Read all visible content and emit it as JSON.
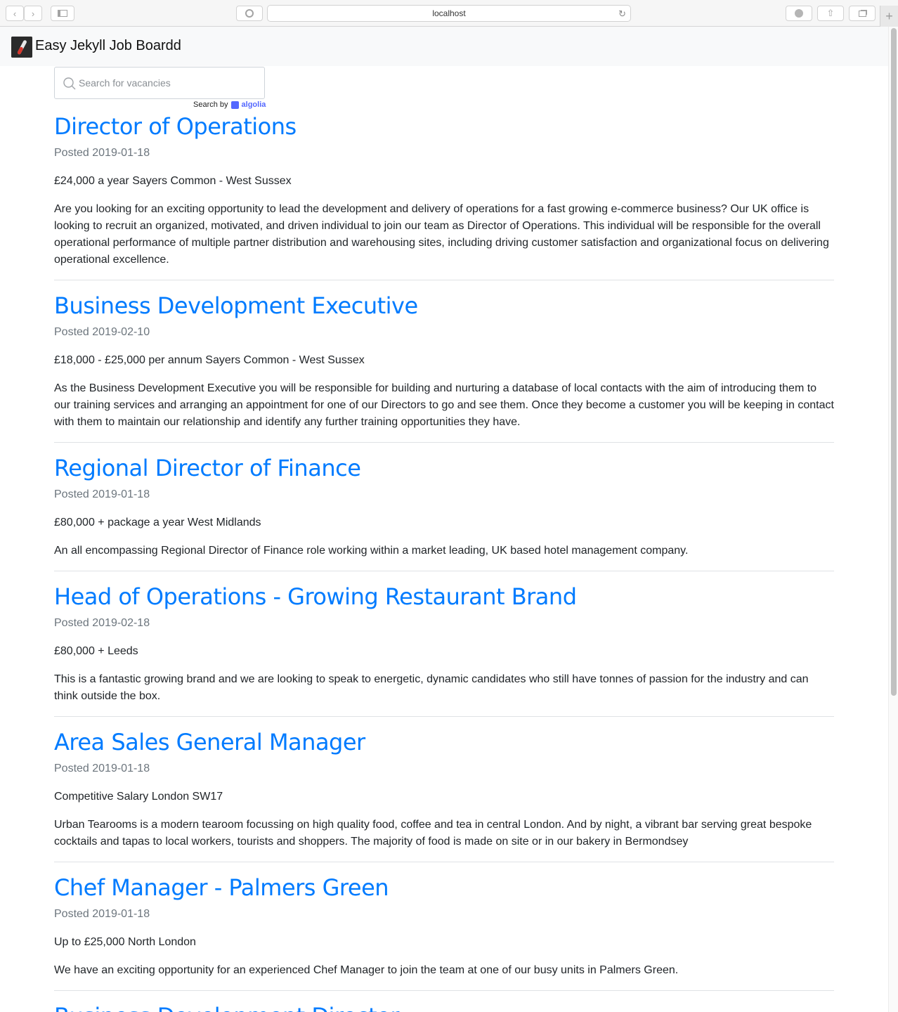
{
  "browser": {
    "url": "localhost"
  },
  "navbar": {
    "brand": "Easy Jekyll Job Boardd"
  },
  "search": {
    "placeholder": "Search for vacancies",
    "powered_by": "Search by",
    "provider": "algolia"
  },
  "jobs": [
    {
      "title": "Director of Operations",
      "posted": "Posted 2019-01-18",
      "salary_location": "£24,000 a year Sayers Common - West Sussex",
      "description": "Are you looking for an exciting opportunity to lead the development and delivery of operations for a fast growing e-commerce business? Our UK office is looking to recruit an organized, motivated, and driven individual to join our team as Director of Operations. This individual will be responsible for the overall operational performance of multiple partner distribution and warehousing sites, including driving customer satisfaction and organizational focus on delivering operational excellence."
    },
    {
      "title": "Business Development Executive",
      "posted": "Posted 2019-02-10",
      "salary_location": "£18,000 - £25,000 per annum Sayers Common - West Sussex",
      "description": "As the Business Development Executive you will be responsible for building and nurturing a database of local contacts with the aim of introducing them to our training services and arranging an appointment for one of our Directors to go and see them. Once they become a customer you will be keeping in contact with them to maintain our relationship and identify any further training opportunities they have."
    },
    {
      "title": "Regional Director of Finance",
      "posted": "Posted 2019-01-18",
      "salary_location": "£80,000 + package a year West Midlands",
      "description": "An all encompassing Regional Director of Finance role working within a market leading, UK based hotel management company."
    },
    {
      "title": "Head of Operations - Growing Restaurant Brand",
      "posted": "Posted 2019-02-18",
      "salary_location": "£80,000 + Leeds",
      "description": "This is a fantastic growing brand and we are looking to speak to energetic, dynamic candidates who still have tonnes of passion for the industry and can think outside the box."
    },
    {
      "title": "Area Sales General Manager",
      "posted": "Posted 2019-01-18",
      "salary_location": "Competitive Salary London SW17",
      "description": "Urban Tearooms is a modern tearoom focussing on high quality food, coffee and tea in central London. And by night, a vibrant bar serving great bespoke cocktails and tapas to local workers, tourists and shoppers. The majority of food is made on site or in our bakery in Bermondsey"
    },
    {
      "title": "Chef Manager - Palmers Green",
      "posted": "Posted 2019-01-18",
      "salary_location": "Up to £25,000 North London",
      "description": "We have an exciting opportunity for an experienced Chef Manager to join the team at one of our busy units in Palmers Green."
    },
    {
      "title": "Business Development Director"
    }
  ]
}
